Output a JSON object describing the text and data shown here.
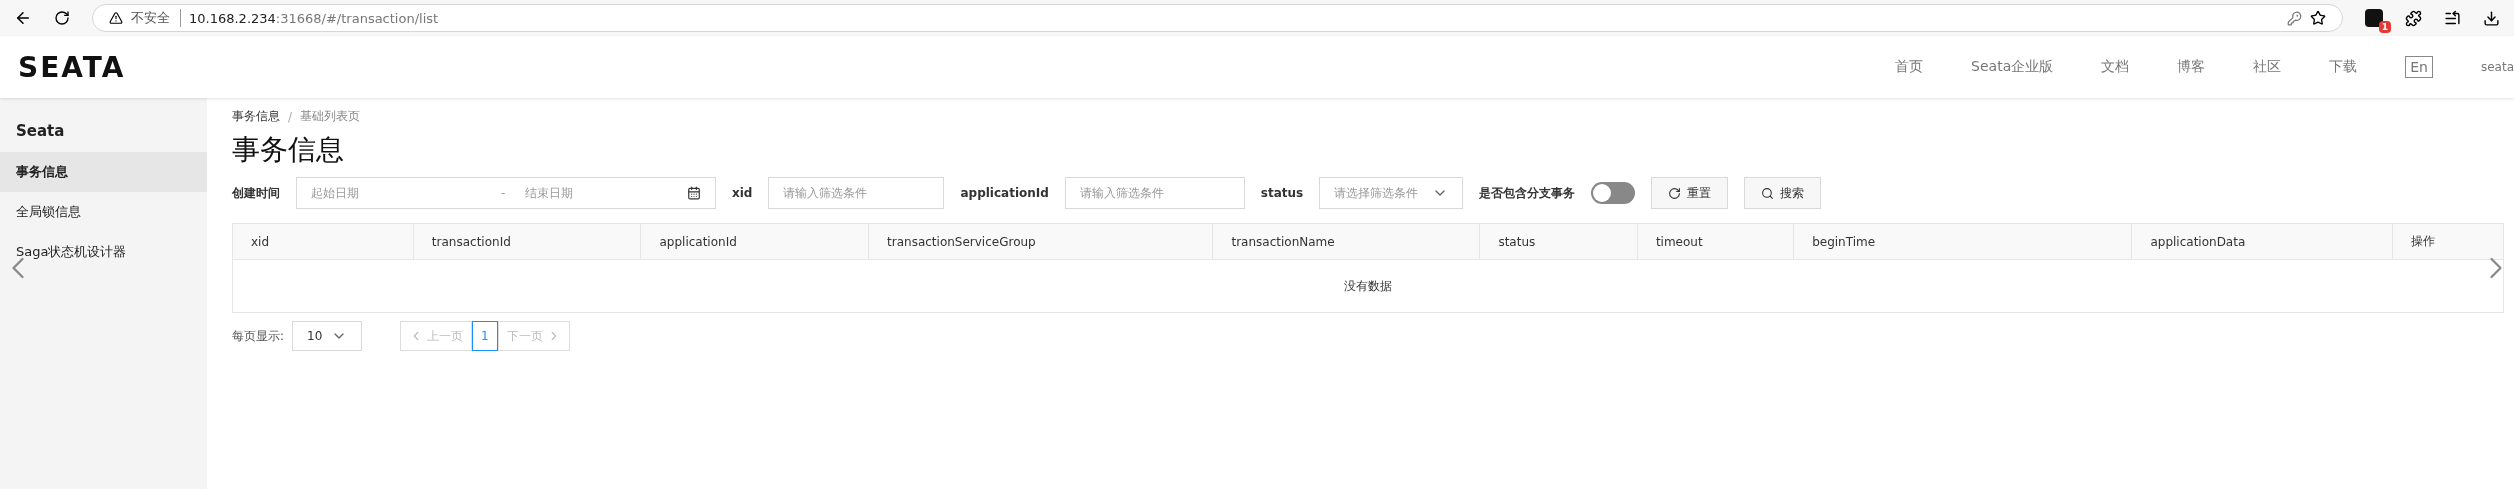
{
  "browser": {
    "security": "不安全",
    "url_host": "10.168.2.234",
    "url_rest": ":31668/#/transaction/list",
    "extension_badge": "1"
  },
  "header": {
    "logo": "SEATA",
    "nav": [
      "首页",
      "Seata企业版",
      "文档",
      "博客",
      "社区",
      "下载"
    ],
    "language": "En",
    "user": "seata"
  },
  "sidebar": {
    "title": "Seata",
    "items": [
      {
        "label": "事务信息",
        "selected": true
      },
      {
        "label": "全局锁信息",
        "selected": false
      },
      {
        "label": "Saga状态机设计器",
        "selected": false
      }
    ]
  },
  "breadcrumb": {
    "items": [
      "事务信息",
      "基础列表页"
    ],
    "separator": "/"
  },
  "title": "事务信息",
  "filters": {
    "created_label": "创建时间",
    "start_placeholder": "起始日期",
    "range_separator": "-",
    "end_placeholder": "结束日期",
    "xid_label": "xid",
    "xid_placeholder": "请输入筛选条件",
    "app_label": "applicationId",
    "app_placeholder": "请输入筛选条件",
    "status_label": "status",
    "status_placeholder": "请选择筛选条件",
    "branch_label": "是否包含分支事务",
    "branch_toggle": {
      "on": false
    },
    "reset": "重置",
    "search": "搜索"
  },
  "table": {
    "columns": [
      "xid",
      "transactionId",
      "applicationId",
      "transactionServiceGroup",
      "transactionName",
      "status",
      "timeout",
      "beginTime",
      "applicationData",
      "操作"
    ],
    "empty": "没有数据"
  },
  "pagination": {
    "page_size_label": "每页显示:",
    "page_size": "10",
    "prev": "上一页",
    "pages": [
      {
        "label": "1",
        "selected": true
      }
    ],
    "next": "下一页"
  }
}
